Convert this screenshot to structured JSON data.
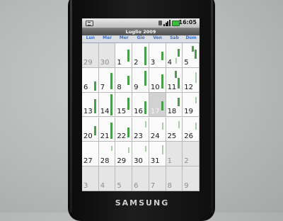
{
  "status_bar": {
    "time": "16:05",
    "icons": [
      "notification-icon",
      "sim-icon",
      "signal-icon",
      "battery-icon"
    ],
    "battery_color": "#3dbb3d"
  },
  "calendar": {
    "month_title": "Luglio 2009",
    "weekdays": [
      "Lun",
      "Mar",
      "Mer",
      "Gio",
      "Ven",
      "Sab",
      "Dom"
    ],
    "weekday_color": "#3a6fd0",
    "event_color": "#47a047",
    "weeks": [
      [
        {
          "day": "29",
          "other": true,
          "events": []
        },
        {
          "day": "30",
          "other": true,
          "events": []
        },
        {
          "day": "1",
          "events": [
            {
              "start": 0.25,
              "end": 0.75
            }
          ]
        },
        {
          "day": "2",
          "events": [
            {
              "start": 0.12,
              "end": 0.9
            }
          ]
        },
        {
          "day": "3",
          "events": [
            {
              "start": 0.35,
              "end": 0.7
            }
          ]
        },
        {
          "day": "4",
          "events": [
            {
              "start": 0.2,
              "end": 0.55
            },
            {
              "start": 0.6,
              "end": 0.85,
              "pale": true
            }
          ]
        },
        {
          "day": "5",
          "events": [
            {
              "start": 0.25,
              "end": 0.65
            },
            {
              "start": 0.1,
              "end": 0.35
            }
          ]
        }
      ],
      [
        {
          "day": "6",
          "events": [
            {
              "start": 0.55,
              "end": 0.95
            }
          ]
        },
        {
          "day": "7",
          "events": [
            {
              "start": 0.2,
              "end": 0.9
            }
          ]
        },
        {
          "day": "8",
          "events": [
            {
              "start": 0.3,
              "end": 0.7
            }
          ]
        },
        {
          "day": "9",
          "events": [
            {
              "start": 0.1,
              "end": 0.75
            }
          ]
        },
        {
          "day": "10",
          "events": [
            {
              "start": 0.25,
              "end": 0.85
            }
          ]
        },
        {
          "day": "11",
          "events": [
            {
              "start": 0.4,
              "end": 0.85
            },
            {
              "start": 0.1,
              "end": 0.4
            }
          ]
        },
        {
          "day": "12",
          "events": [
            {
              "start": 0.15,
              "end": 0.6,
              "pale": true
            }
          ]
        }
      ],
      [
        {
          "day": "13",
          "events": [
            {
              "start": 0.25,
              "end": 0.85
            }
          ]
        },
        {
          "day": "14",
          "events": [
            {
              "start": 0.05,
              "end": 0.95
            }
          ]
        },
        {
          "day": "15",
          "events": [
            {
              "start": 0.2,
              "end": 0.7
            }
          ]
        },
        {
          "day": "16",
          "events": [
            {
              "start": 0.35,
              "end": 0.9
            }
          ]
        },
        {
          "day": "17",
          "today": true,
          "events": [
            {
              "start": 0.35,
              "end": 0.75
            }
          ]
        },
        {
          "day": "18",
          "events": [
            {
              "start": 0.2,
              "end": 0.55
            }
          ]
        },
        {
          "day": "19",
          "events": [
            {
              "start": 0.15,
              "end": 0.45,
              "pale": true
            }
          ]
        }
      ],
      [
        {
          "day": "20",
          "events": [
            {
              "start": 0.35,
              "end": 0.75
            }
          ]
        },
        {
          "day": "21",
          "events": [
            {
              "start": 0.2,
              "end": 0.9
            }
          ]
        },
        {
          "day": "22",
          "events": [
            {
              "start": 0.4,
              "end": 0.85
            }
          ]
        },
        {
          "day": "23",
          "events": [
            {
              "start": 0.15,
              "end": 0.4,
              "pale": true
            }
          ]
        },
        {
          "day": "24",
          "events": [
            {
              "start": 0.2,
              "end": 0.5,
              "pale": true
            }
          ]
        },
        {
          "day": "25",
          "events": [
            {
              "start": 0.15,
              "end": 0.45,
              "pale": true
            }
          ]
        },
        {
          "day": "26",
          "events": [
            {
              "start": 0.2,
              "end": 0.5,
              "pale": true
            }
          ]
        }
      ],
      [
        {
          "day": "27",
          "events": []
        },
        {
          "day": "28",
          "events": [
            {
              "start": 0.15,
              "end": 0.35,
              "pale": true
            }
          ]
        },
        {
          "day": "29",
          "events": [
            {
              "start": 0.2,
              "end": 0.45,
              "pale": true
            }
          ]
        },
        {
          "day": "30",
          "events": [
            {
              "start": 0.15,
              "end": 0.4,
              "pale": true
            }
          ]
        },
        {
          "day": "31",
          "events": [
            {
              "start": 0.1,
              "end": 0.5,
              "pale": true
            }
          ]
        },
        {
          "day": "1",
          "other": true,
          "events": []
        },
        {
          "day": "2",
          "other": true,
          "events": []
        }
      ],
      [
        {
          "day": "3",
          "other": true,
          "events": []
        },
        {
          "day": "4",
          "other": true,
          "events": []
        },
        {
          "day": "5",
          "other": true,
          "events": []
        },
        {
          "day": "6",
          "other": true,
          "events": []
        },
        {
          "day": "7",
          "other": true,
          "events": []
        },
        {
          "day": "8",
          "other": true,
          "events": []
        },
        {
          "day": "9",
          "other": true,
          "events": []
        }
      ]
    ]
  },
  "device": {
    "brand": "SAMSUNG"
  }
}
